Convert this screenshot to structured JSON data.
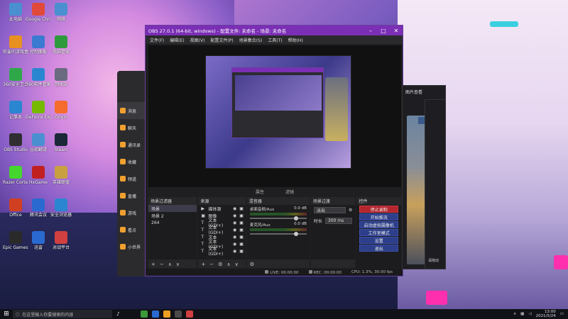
{
  "desktop_icons": [
    {
      "label": "此电脑",
      "color": "#4a90d0"
    },
    {
      "label": "Google Chrome",
      "color": "#e14a3b"
    },
    {
      "label": "网络",
      "color": "#4a90d0"
    },
    {
      "label": "你要的游戏盒",
      "color": "#e89020"
    },
    {
      "label": "控制面板",
      "color": "#3a7ad0"
    },
    {
      "label": "电脑管家",
      "color": "#2e9a3e"
    },
    {
      "label": "360安全卫士",
      "color": "#2fa84a"
    },
    {
      "label": "360软件管家",
      "color": "#2a86d0"
    },
    {
      "label": "回收站",
      "color": "#6a6a80"
    },
    {
      "label": "记事本",
      "color": "#2a86d0"
    },
    {
      "label": "GeForce Experience",
      "color": "#76b900"
    },
    {
      "label": "Origin",
      "color": "#f56c2d"
    },
    {
      "label": "OBS Studio",
      "color": "#302e31"
    },
    {
      "label": "谷歌翻译",
      "color": "#4a90d0"
    },
    {
      "label": "Steam",
      "color": "#1b2838"
    },
    {
      "label": "Razer Cortex",
      "color": "#44d62c"
    },
    {
      "label": "HxGame",
      "color": "#c02020"
    },
    {
      "label": "英雄联盟",
      "color": "#c8a040"
    },
    {
      "label": "Office",
      "color": "#d04020"
    },
    {
      "label": "腾讯会议",
      "color": "#2a6ad0"
    },
    {
      "label": "安全浏览器",
      "color": "#2a86d0"
    },
    {
      "label": "Epic Games Launcher",
      "color": "#2a2a2a"
    },
    {
      "label": "迅雷",
      "color": "#2a6ad0"
    },
    {
      "label": "对战平台",
      "color": "#d04040"
    }
  ],
  "chat_app": {
    "items": [
      "消息",
      "聊天",
      "通讯录",
      "收藏",
      "频道",
      "直播",
      "游戏",
      "看点",
      "小世界"
    ]
  },
  "obs": {
    "title": "OBS 27.0.1 (64-bit, windows) - 配置文件: 未命名 - 场景: 未命名",
    "menu": [
      "文件(F)",
      "编辑(E)",
      "视图(V)",
      "配置文件(P)",
      "场景集合(S)",
      "工具(T)",
      "帮助(H)"
    ],
    "preview_toolbar": [
      "属性",
      "滤镜"
    ],
    "scenes": {
      "header": "场景过滤器",
      "items": [
        "场景",
        "场景 2",
        "264"
      ]
    },
    "sources": {
      "header": "来源",
      "items": [
        {
          "icon": "▶",
          "label": "媒体源"
        },
        {
          "icon": "▣",
          "label": "图像"
        },
        {
          "icon": "T",
          "label": "文本 (GDI+)"
        },
        {
          "icon": "T",
          "label": "文本 (GDI+)"
        },
        {
          "icon": "T",
          "label": "文本"
        },
        {
          "icon": "T",
          "label": "文本 (GDI+)"
        },
        {
          "icon": "T",
          "label": "文本 (GDI+)"
        }
      ]
    },
    "mixer": {
      "header": "混音器",
      "channels": [
        {
          "name": "桌面音频/Aux",
          "db": "0.0 dB"
        },
        {
          "name": "麦克风/Aux",
          "db": "0.0 dB"
        }
      ]
    },
    "transitions": {
      "header": "场景过渡",
      "type_label": "淡出",
      "duration_label": "时长",
      "duration_value": "300 ms"
    },
    "controls": {
      "header": "控件",
      "buttons": [
        "停止录制",
        "开始推流",
        "启动虚拟摄像机",
        "工作室模式",
        "设置",
        "退出"
      ]
    },
    "status": {
      "live": "LIVE: 00:00:00",
      "rec": "REC: 00:00:00",
      "cpu": "CPU: 1.3%, 30.00 fps"
    }
  },
  "right_window": {
    "title": "图片查看",
    "caption": "请拖动"
  },
  "taskbar": {
    "search_placeholder": "在这里输入你要搜索的内容",
    "time": "13:00",
    "date": "2021/5/24",
    "app_colors": [
      "#3a9a3a",
      "#2a6ad0",
      "#f0a020",
      "#4a4a4a",
      "#d04040"
    ]
  }
}
